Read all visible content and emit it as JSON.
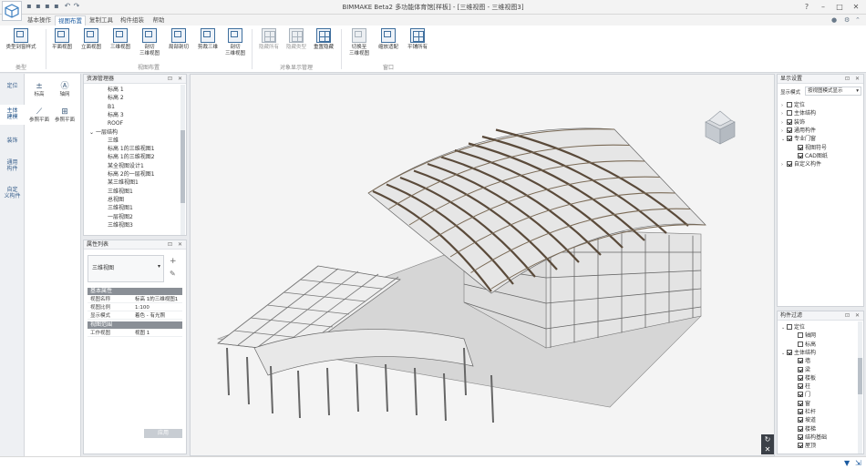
{
  "window": {
    "title": "BIMMAKE Beta2 多功能体育馆[样板]  - [三维视图 - 三维视图3]"
  },
  "ribbon_tabs": [
    "基本操作",
    "视图布置",
    "复制工具",
    "构件组装",
    "帮助"
  ],
  "ribbon": {
    "groups": [
      {
        "label": "类型",
        "buttons": [
          "类型到窗样式"
        ]
      },
      {
        "label": "视图布置",
        "buttons": [
          "平面视图",
          "立面视图",
          "三维视图",
          "剖切\n三维视图",
          "局部剖切",
          "剪裁三维",
          "剖切\n三维视图"
        ]
      },
      {
        "label": "对象显示管理",
        "buttons": [
          "隐藏所有",
          "隐藏类型",
          "重置隐藏"
        ]
      },
      {
        "label": "窗口",
        "buttons": [
          "切换至\n三维视图",
          "缩放适配",
          "平铺所有"
        ]
      }
    ]
  },
  "left_tabs": [
    "定位",
    "主体\n建模",
    "装饰",
    "通用\n构件",
    "自定\n义构件"
  ],
  "tool_panel": {
    "tools": [
      {
        "label": "标高",
        "icon": "level-icon"
      },
      {
        "label": "轴网",
        "icon": "grid-icon"
      },
      {
        "label": "参照平面",
        "icon": "reference-plane-icon"
      },
      {
        "label": "参照平面",
        "icon": "reference-plane-icon"
      }
    ]
  },
  "resource_manager": {
    "title": "资源管理器",
    "items": [
      "标高 1",
      "标高 2",
      "B1",
      "标高 3",
      "ROOF",
      "一层结构",
      "三维",
      "标高 1的三维视图1",
      "标高 1的三维视图2",
      "某全视图设计1",
      "标高 2的一层视图1",
      "某三维视图1",
      "三维视图1",
      "总视图",
      "三维视图1",
      "一层视图2",
      "三维视图3"
    ]
  },
  "properties": {
    "title": "属性列表",
    "type_value": "三维视图",
    "sections": [
      {
        "name": "基本属性",
        "rows": [
          [
            "视图名称",
            "标高 1的三维视图1"
          ],
          [
            "视图比例",
            "1:100"
          ],
          [
            "显示模式",
            "着色 - 有光照"
          ]
        ]
      },
      {
        "name": "视图范围",
        "rows": [
          [
            "工作视图",
            "视图 1"
          ]
        ]
      }
    ],
    "apply_label": "应用"
  },
  "display_panel": {
    "title": "显示设置",
    "mode_label": "按视图模式显示",
    "mode_prefix": "显示模式",
    "items": [
      {
        "label": "定位",
        "checked": false,
        "expand": "›"
      },
      {
        "label": "主体结构",
        "checked": false,
        "expand": "›"
      },
      {
        "label": "装饰",
        "checked": true,
        "expand": "›"
      },
      {
        "label": "通用构件",
        "checked": true,
        "expand": "›"
      },
      {
        "label": "专业门窗",
        "checked": true,
        "expand": "⌄"
      },
      {
        "label": "视图符号",
        "checked": true,
        "child": true
      },
      {
        "label": "CAD图纸",
        "checked": true,
        "child": true
      },
      {
        "label": "自定义构件",
        "checked": true,
        "expand": "›"
      }
    ]
  },
  "filter_panel": {
    "title": "构件过滤",
    "items": [
      {
        "label": "定位",
        "checked": false,
        "expand": "⌄"
      },
      {
        "label": "轴网",
        "checked": false,
        "child": true
      },
      {
        "label": "标高",
        "checked": false,
        "child": true
      },
      {
        "label": "主体结构",
        "checked": true,
        "expand": "⌄"
      },
      {
        "label": "墙",
        "checked": true,
        "child": true
      },
      {
        "label": "梁",
        "checked": true,
        "child": true
      },
      {
        "label": "楼板",
        "checked": true,
        "child": true
      },
      {
        "label": "柱",
        "checked": true,
        "child": true
      },
      {
        "label": "门",
        "checked": true,
        "child": true
      },
      {
        "label": "窗",
        "checked": true,
        "child": true
      },
      {
        "label": "栏杆",
        "checked": true,
        "child": true
      },
      {
        "label": "坡道",
        "checked": true,
        "child": true
      },
      {
        "label": "楼梯",
        "checked": true,
        "child": true
      },
      {
        "label": "结构基础",
        "checked": true,
        "child": true
      },
      {
        "label": "屋顶",
        "checked": true,
        "child": true
      }
    ]
  },
  "colors": {
    "accent": "#1a5aa0",
    "viewport_bg": "#f4f4f4",
    "roof_beam": "#5a4a3a",
    "frame": "#d9d9d9"
  }
}
